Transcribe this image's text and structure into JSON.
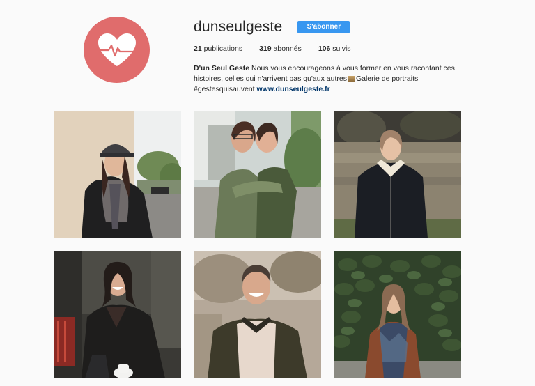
{
  "profile": {
    "username": "dunseulgeste",
    "follow_label": "S'abonner",
    "stats": {
      "publications_count": "21",
      "publications_label": "publications",
      "followers_count": "319",
      "followers_label": "abonnés",
      "following_count": "106",
      "following_label": "suivis"
    },
    "bio": {
      "name": "D'un Seul Geste",
      "text_part1": "Nous vous encourageons à vous former en vous racontant ces histoires, celles qui n'arrivent pas qu'aux autres",
      "text_part2": "Galerie de portraits",
      "hashtag": "#gestesquisauvent",
      "link": "www.dunseulgeste.fr"
    }
  },
  "colors": {
    "avatar_bg": "#e06c6c",
    "follow_button": "#3897f0",
    "link": "#003569"
  },
  "posts": [
    {
      "subject": "woman-in-cap-portrait"
    },
    {
      "subject": "two-women-hugging"
    },
    {
      "subject": "woman-by-river"
    },
    {
      "subject": "woman-laughing-at-cafe"
    },
    {
      "subject": "smiling-man-portrait"
    },
    {
      "subject": "woman-in-front-of-ivy"
    }
  ]
}
